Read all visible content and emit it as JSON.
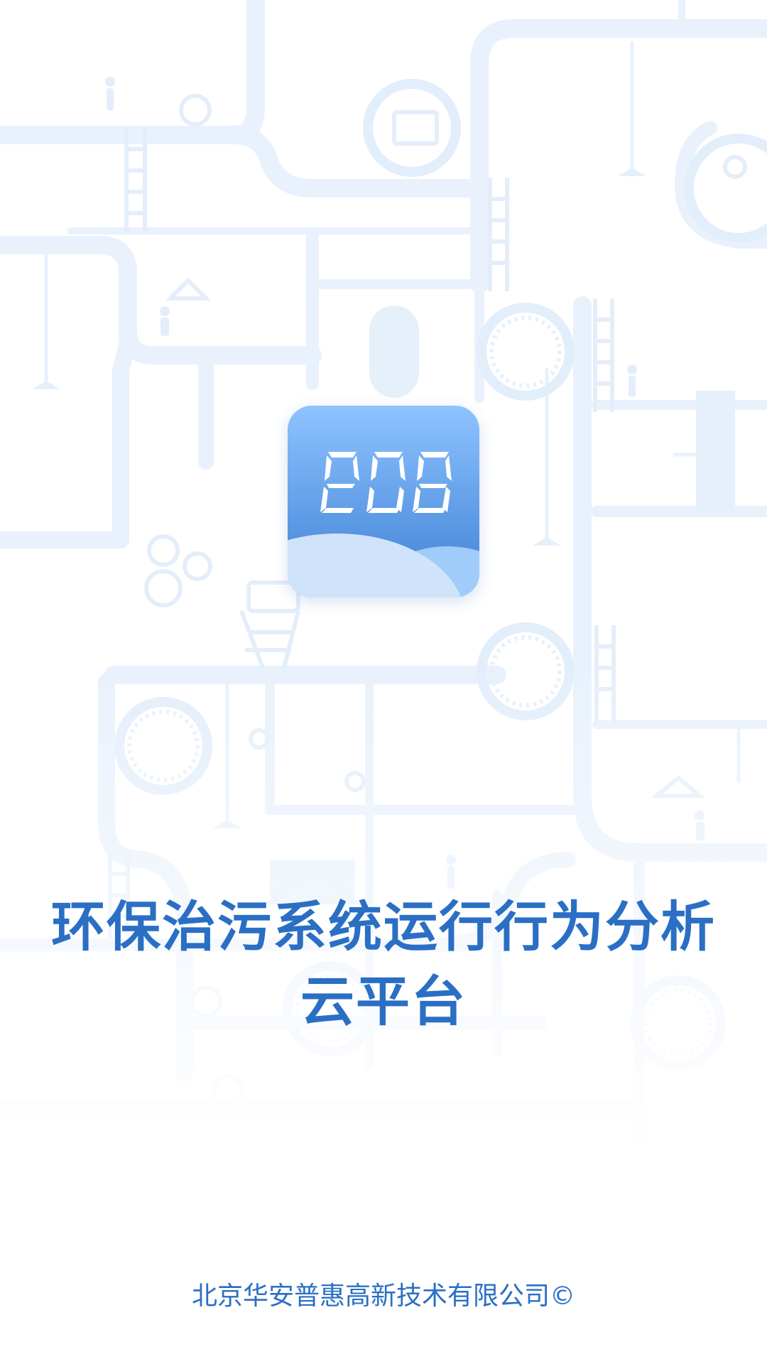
{
  "splash": {
    "background_image": "pipeline-network-illustration",
    "app_icon": "digital-display-cloud-icon",
    "title_line_1": "环保治污系统运行行为分析",
    "title_line_2": "云平台",
    "copyright": "北京华安普惠高新技术有限公司©"
  },
  "colors": {
    "brand_blue": "#2a6fc4",
    "pipe_tint": "#e9f2fc",
    "icon_top": "#8ec3ff",
    "icon_bottom": "#3d7fd4",
    "cloud_light": "#cfe4fb",
    "cloud_mid": "#9fccf8"
  }
}
